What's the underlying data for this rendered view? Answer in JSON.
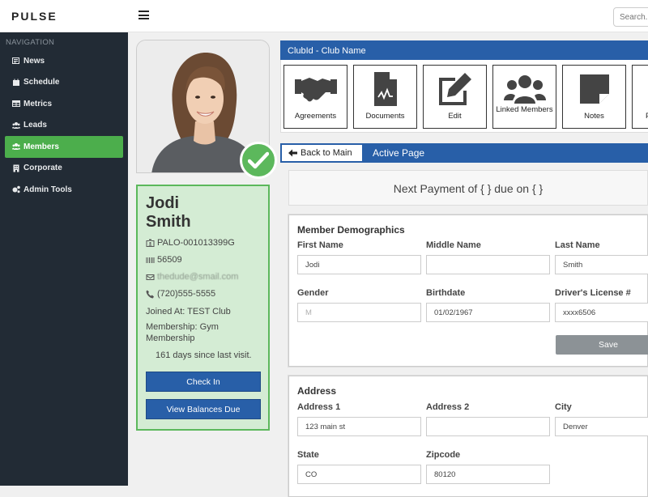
{
  "app": {
    "logo": "PULSE"
  },
  "search": {
    "placeholder": "Search..."
  },
  "sidebar": {
    "heading": "NAVIGATION",
    "items": [
      {
        "label": "News",
        "icon": "newspaper-icon"
      },
      {
        "label": "Schedule",
        "icon": "calendar-icon"
      },
      {
        "label": "Metrics",
        "icon": "table-icon"
      },
      {
        "label": "Leads",
        "icon": "users-icon"
      },
      {
        "label": "Members",
        "icon": "users-icon",
        "active": true
      },
      {
        "label": "Corporate",
        "icon": "building-icon"
      },
      {
        "label": "Admin Tools",
        "icon": "cogs-icon"
      }
    ]
  },
  "member": {
    "first_name": "Jodi",
    "last_name": "Smith",
    "member_id": "PALO-001013399G",
    "barcode": "56509",
    "email": "thedude@smail.com",
    "phone": "(720)555-5555",
    "joined": "Joined At: TEST Club",
    "membership": "Membership: Gym Membership",
    "last_visit": "161 days since last visit.",
    "status": "checked-in"
  },
  "actions": {
    "check_in": "Check In",
    "view_balances": "View Balances Due"
  },
  "club": {
    "header": "ClubId - Club Name",
    "tiles": [
      {
        "label": "Agreements",
        "icon": "handshake-icon"
      },
      {
        "label": "Documents",
        "icon": "document-icon"
      },
      {
        "label": "Edit",
        "icon": "edit-icon"
      },
      {
        "label": "Linked Members",
        "icon": "users-icon"
      },
      {
        "label": "Notes",
        "icon": "sticky-note-icon"
      },
      {
        "label": "P",
        "icon": "unknown-icon"
      }
    ]
  },
  "nav": {
    "back_label": "Back to Main",
    "active_page": "Active Page"
  },
  "payment": {
    "text": "Next Payment of { } due on { }"
  },
  "demographics": {
    "title": "Member Demographics",
    "first_name_label": "First Name",
    "first_name_value": "Jodi",
    "middle_name_label": "Middle Name",
    "middle_name_value": "",
    "last_name_label": "Last Name",
    "last_name_value": "Smith",
    "gender_label": "Gender",
    "gender_value": "M",
    "birthdate_label": "Birthdate",
    "birthdate_value": "01/02/1967",
    "license_label": "Driver's License #",
    "license_value": "xxxx6506",
    "save_label": "Save"
  },
  "address": {
    "title": "Address",
    "address1_label": "Address 1",
    "address1_value": "123 main st",
    "address2_label": "Address 2",
    "address2_value": "",
    "city_label": "City",
    "city_value": "Denver",
    "state_label": "State",
    "state_value": "CO",
    "zip_label": "Zipcode",
    "zip_value": "80120"
  },
  "colors": {
    "primary": "#285fa8",
    "success": "#5cb85c",
    "sidebar": "#222b35",
    "info_card": "#d4ecd4"
  }
}
